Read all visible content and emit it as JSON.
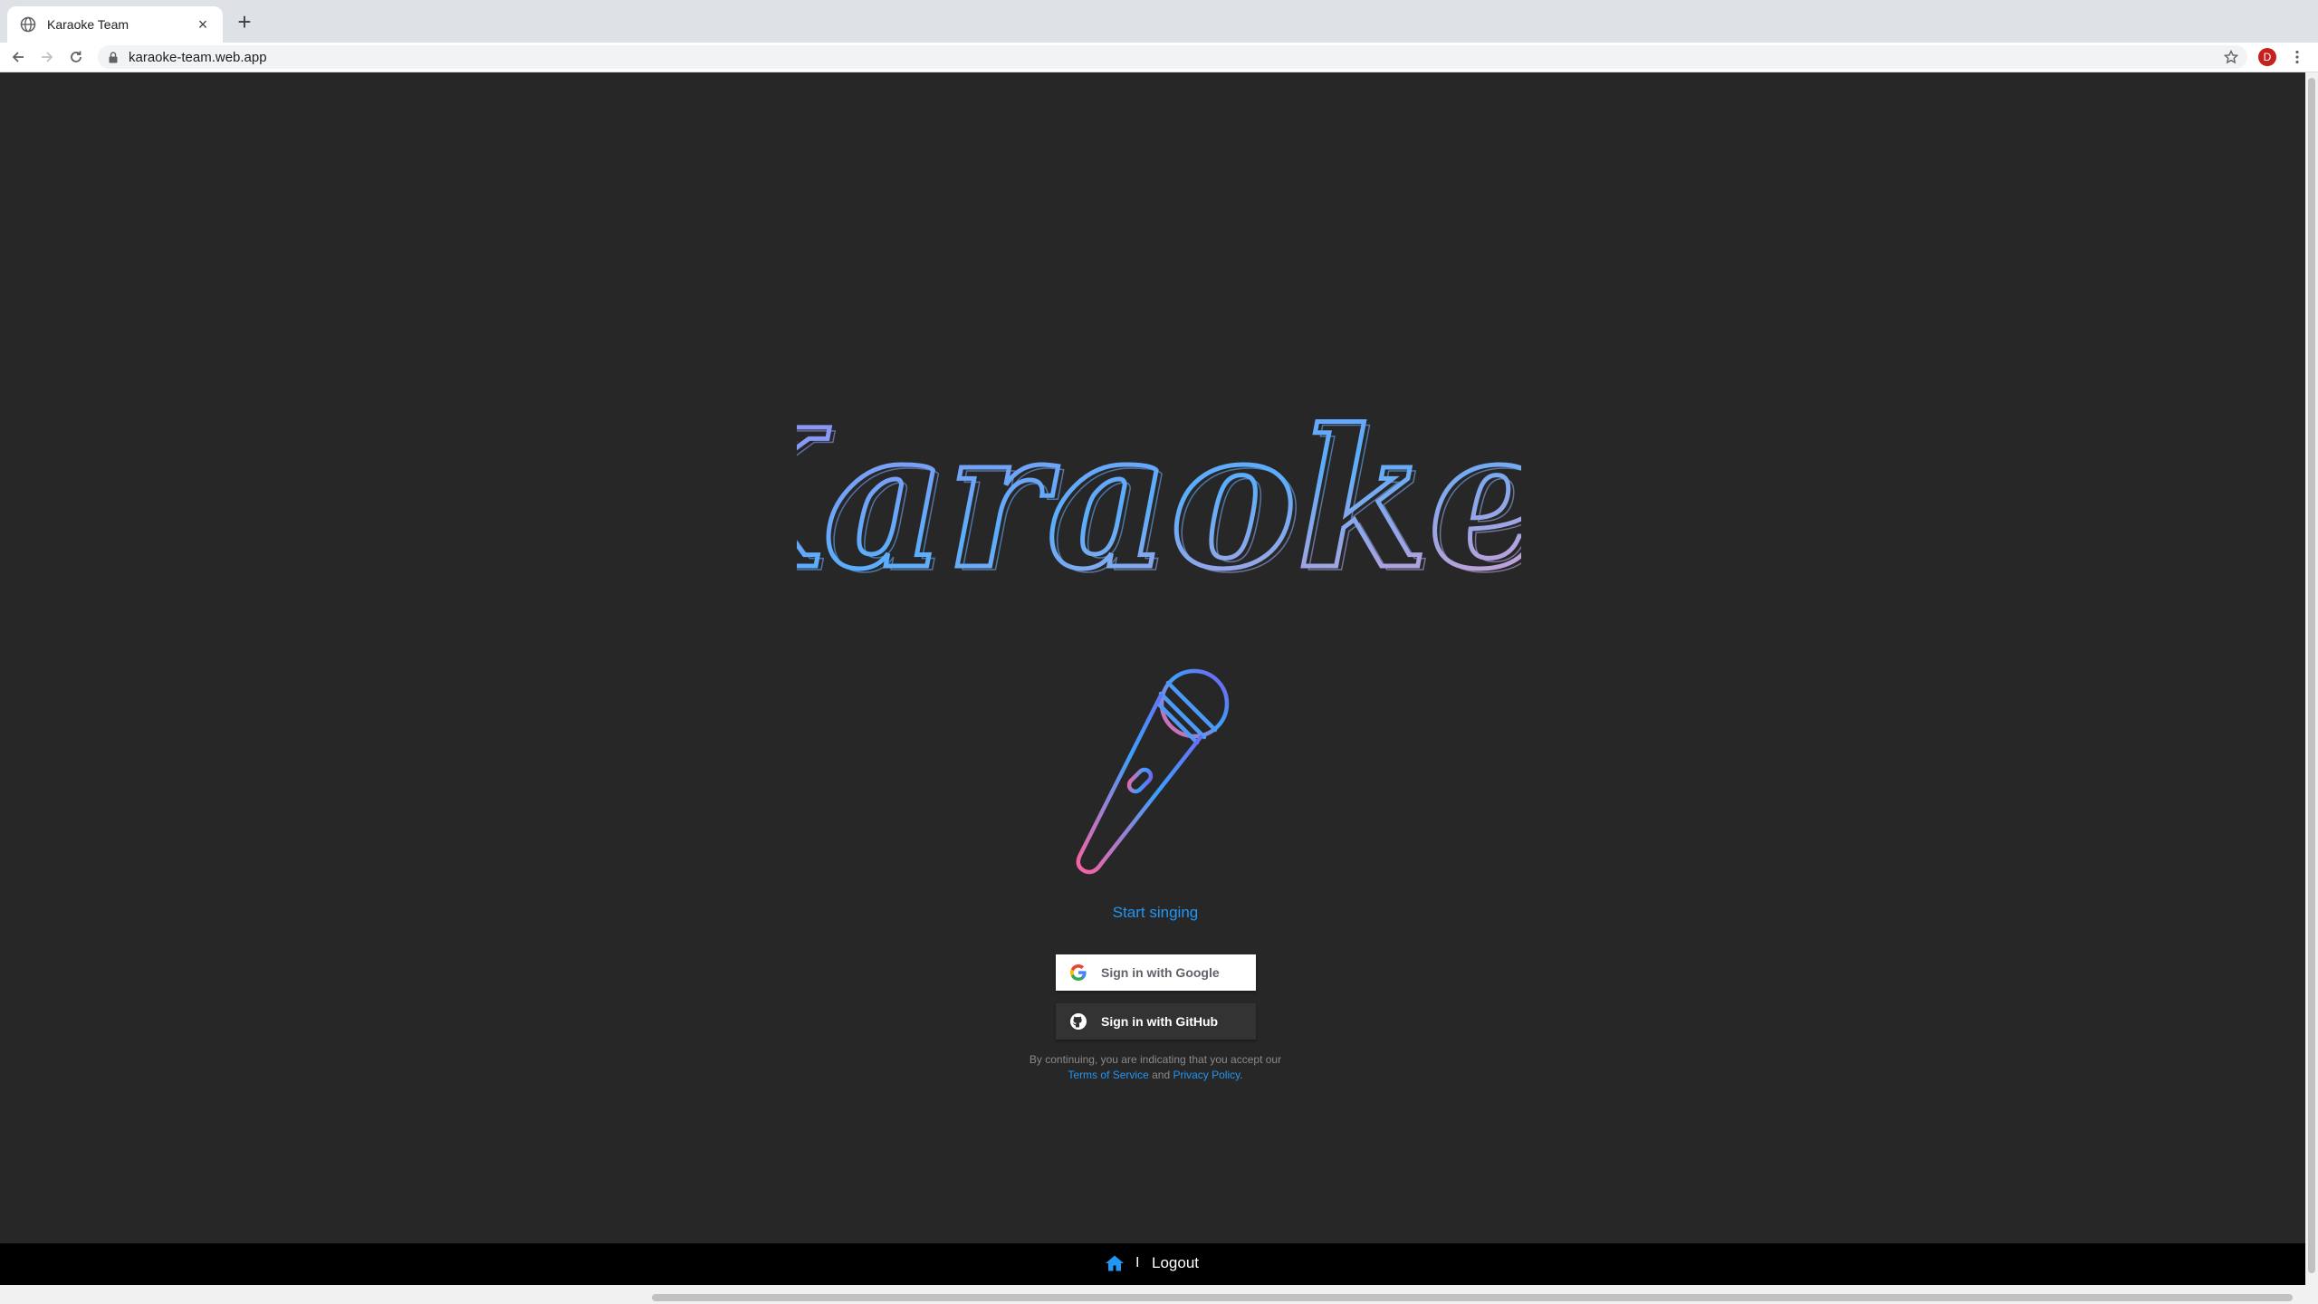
{
  "browser": {
    "tab_title": "Karaoke Team",
    "tab_close": "×",
    "new_tab": "+",
    "url": "karaoke-team.web.app",
    "profile_initial": "D"
  },
  "page": {
    "logo_text": "Karaokey",
    "start_link": "Start singing",
    "google_button": "Sign in with Google",
    "github_button": "Sign in with GitHub",
    "tos_prefix": "By continuing, you are indicating that you accept our",
    "tos_link": "Terms of Service",
    "tos_and": "and",
    "privacy_link": "Privacy Policy",
    "tos_suffix": "."
  },
  "footer": {
    "separator": "I",
    "logout": "Logout"
  },
  "colors": {
    "background": "#282728",
    "link": "#2196f3",
    "logo_gradient": [
      "#a48cf0",
      "#5aaefc",
      "#f49ac6"
    ],
    "mic_gradient": [
      "#7b5cf0",
      "#3aa0ff",
      "#ff5fa2"
    ]
  },
  "icons": {
    "tab_favicon": "globe-icon",
    "back": "arrow-left-icon",
    "forward": "arrow-right-icon",
    "reload": "reload-icon",
    "lock": "lock-icon",
    "star": "star-icon",
    "menu": "kebab-menu-icon",
    "mic": "microphone-icon",
    "google": "google-g-icon",
    "github": "github-icon",
    "home": "home-icon"
  }
}
